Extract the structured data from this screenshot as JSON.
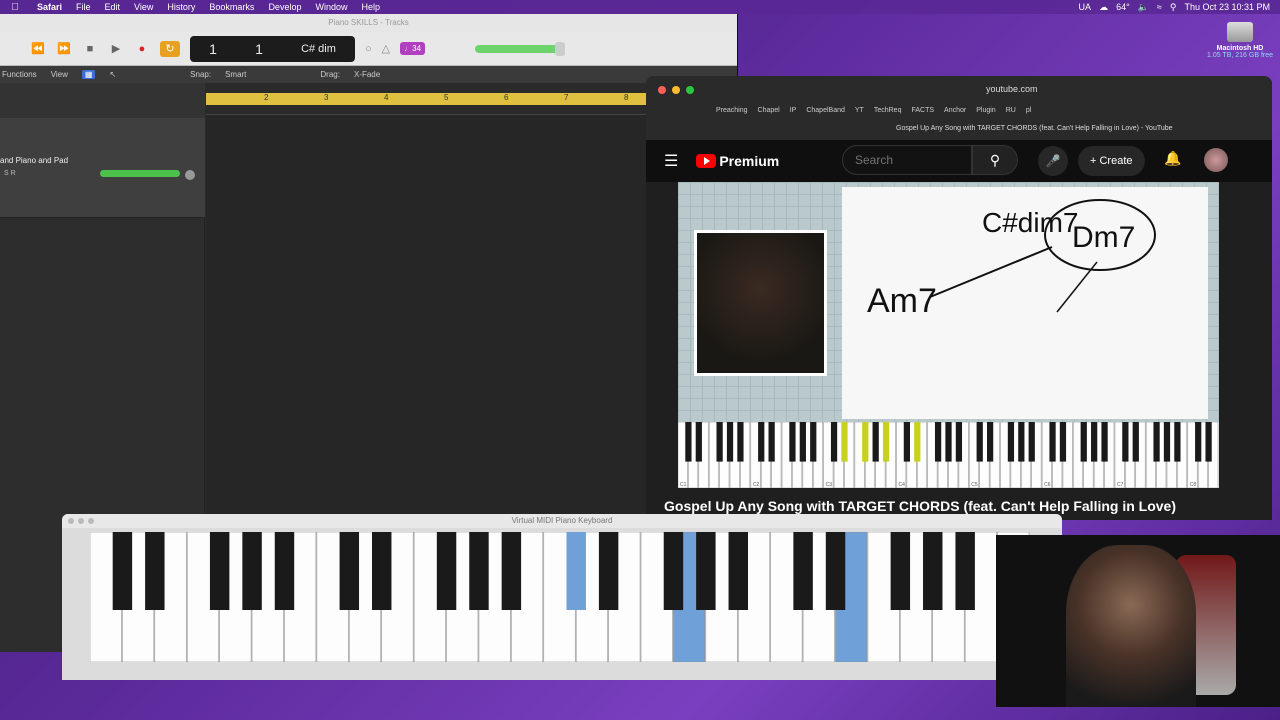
{
  "menubar": {
    "app": "Safari",
    "items": [
      "File",
      "Edit",
      "View",
      "History",
      "Bookmarks",
      "Develop",
      "Window",
      "Help"
    ],
    "weather": "64°",
    "clock": "Thu Oct 23  10:31 PM",
    "input_source": "UA"
  },
  "desktop": {
    "disk_name": "Macintosh HD",
    "disk_info": "1.05 TB, 216 GB free"
  },
  "logic": {
    "title": "Piano SKILLS - Tracks",
    "lcd_bar": "1",
    "lcd_beat": "1",
    "lcd_chord": "C# dim",
    "badge": "♩34",
    "toolbar": {
      "functions": "Functions",
      "view": "View",
      "snap_label": "Snap:",
      "snap_value": "Smart",
      "drag_label": "Drag:",
      "drag_value": "X-Fade"
    },
    "ruler": [
      "2",
      "3",
      "4",
      "5",
      "6",
      "7",
      "8"
    ],
    "track_name": "and Piano and Pad",
    "track_controls": "S  R"
  },
  "safari": {
    "address": "youtube.com",
    "favorites": [
      "Preaching",
      "Chapel",
      "IP",
      "ChapelBand",
      "YT",
      "TechReq",
      "FACTS",
      "Anchor",
      "Plugin",
      "RU",
      "pl"
    ],
    "tab_title": "Gospel Up Any Song with TARGET CHORDS (feat. Can't Help Falling in Love) - YouTube"
  },
  "youtube": {
    "logo_text": "Premium",
    "search_placeholder": "Search",
    "create_label": "Create",
    "video_title": "Gospel Up Any Song with TARGET CHORDS (feat. Can't Help Falling in Love)",
    "board": {
      "chord1": "C#dim7",
      "chord2": "Dm7",
      "chord3": "Am7"
    },
    "piano_labels": [
      "C1",
      "C2",
      "C3",
      "C4",
      "C5",
      "C6",
      "C7",
      "C8"
    ]
  },
  "vmpk": {
    "title": "Virtual MIDI Piano Keyboard"
  },
  "colors": {
    "accent_orange": "#e8a020",
    "record_red": "#e02020",
    "yt_red": "#ff0000",
    "highlight_blue": "#6fa0d8",
    "highlight_green": "#c8d020"
  }
}
